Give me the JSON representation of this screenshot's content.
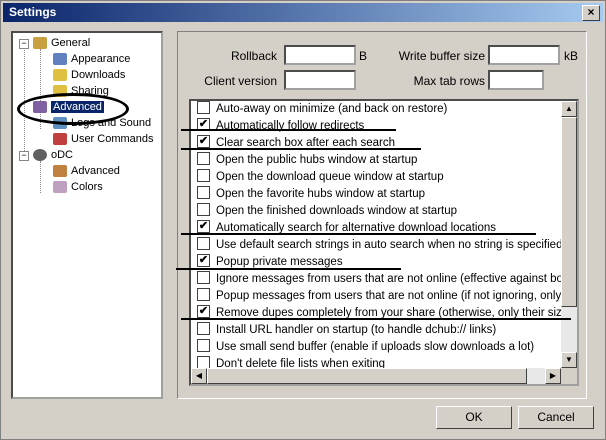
{
  "window": {
    "title": "Settings",
    "close_glyph": "×"
  },
  "tree": {
    "items": [
      {
        "label": "General",
        "icon": "general-icon",
        "color": "#c8a040"
      },
      {
        "label": "Appearance",
        "icon": "appearance-icon",
        "color": "#6080c0"
      },
      {
        "label": "Downloads",
        "icon": "downloads-icon",
        "color": "#e0c040"
      },
      {
        "label": "Sharing",
        "icon": "sharing-icon",
        "color": "#e0c040"
      },
      {
        "label": "Advanced",
        "icon": "advanced-icon",
        "color": "#8060a0"
      },
      {
        "label": "Logs and Sound",
        "icon": "logs-icon",
        "color": "#6090c0"
      },
      {
        "label": "User Commands",
        "icon": "commands-icon",
        "color": "#c04040"
      },
      {
        "label": "oDC",
        "icon": "odc-icon",
        "color": "#606060"
      },
      {
        "label": "Advanced",
        "icon": "odc-advanced-icon",
        "color": "#c08040"
      },
      {
        "label": "Colors",
        "icon": "colors-icon",
        "color": "#c0a0c0"
      }
    ],
    "expander": "−"
  },
  "fields": {
    "rollback_label": "Rollback",
    "rollback_value": "",
    "rollback_unit": "B",
    "write_buffer_label": "Write buffer size",
    "write_buffer_value": "",
    "write_buffer_unit": "kB",
    "client_version_label": "Client version",
    "client_version_value": "",
    "max_tab_rows_label": "Max tab rows",
    "max_tab_rows_value": ""
  },
  "options": [
    {
      "label": "Auto-away on minimize (and back on restore)",
      "checked": false
    },
    {
      "label": "Automatically follow redirects",
      "checked": true
    },
    {
      "label": "Clear search box after each search",
      "checked": true
    },
    {
      "label": "Open the public hubs window at startup",
      "checked": false
    },
    {
      "label": "Open the download queue window at startup",
      "checked": false
    },
    {
      "label": "Open the favorite hubs window at startup",
      "checked": false
    },
    {
      "label": "Open the finished downloads window at startup",
      "checked": false
    },
    {
      "label": "Automatically search for alternative download locations",
      "checked": true
    },
    {
      "label": "Use default search strings in auto search when no string is specified",
      "checked": false
    },
    {
      "label": "Popup private messages",
      "checked": true
    },
    {
      "label": "Ignore messages from users that are not online (effective against bots)",
      "checked": false
    },
    {
      "label": "Popup messages from users that are not online (if not ignoring, only message",
      "checked": false
    },
    {
      "label": "Remove dupes completely from your share (otherwise, only their size is a",
      "checked": true
    },
    {
      "label": "Install URL handler on startup (to handle dchub:// links)",
      "checked": false
    },
    {
      "label": "Use small send buffer (enable if uploads slow downloads a lot)",
      "checked": false
    },
    {
      "label": "Don't delete file lists when exiting",
      "checked": false
    }
  ],
  "checkmark": "✔",
  "scroll_glyphs": {
    "up": "▲",
    "down": "▼",
    "left": "◀",
    "right": "▶"
  },
  "buttons": {
    "ok": "OK",
    "cancel": "Cancel"
  }
}
